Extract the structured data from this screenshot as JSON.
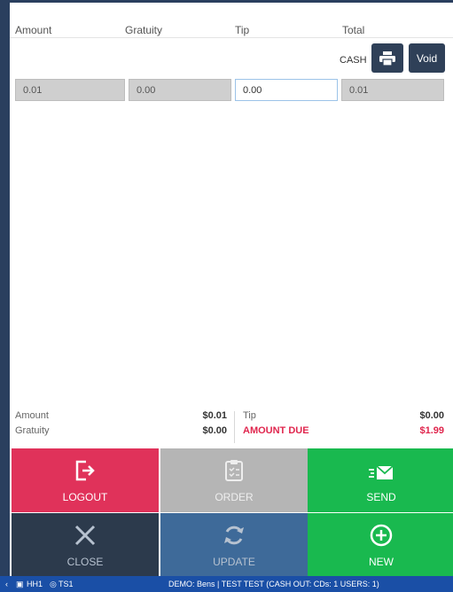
{
  "headers": {
    "amount": "Amount",
    "gratuity": "Gratuity",
    "tip": "Tip",
    "total": "Total"
  },
  "payment": {
    "method": "CASH",
    "void_label": "Void",
    "amount": "0.01",
    "gratuity": "0.00",
    "tip": "0.00",
    "total": "0.01"
  },
  "summary": {
    "amount_label": "Amount",
    "amount_value": "$0.01",
    "gratuity_label": "Gratuity",
    "gratuity_value": "$0.00",
    "tip_label": "Tip",
    "tip_value": "$0.00",
    "due_label": "AMOUNT DUE",
    "due_value": "$1.99"
  },
  "actions": {
    "logout": "LOGOUT",
    "order": "ORDER",
    "send": "SEND",
    "close": "CLOSE",
    "update": "UPDATE",
    "new": "NEW"
  },
  "status_bar": {
    "left": "HH1",
    "station": "TS1",
    "center": "DEMO: Bens | TEST TEST (CASH OUT: CDs: 1 USERS: 1)"
  },
  "colors": {
    "logout": "#e0325a",
    "order": "#b5b5b5",
    "send": "#19b94f",
    "close": "#2c3a4c",
    "update": "#3e6a99",
    "new": "#19b94f",
    "due": "#e0254d"
  },
  "icons": {
    "print": "printer-icon",
    "logout": "logout-icon",
    "order": "clipboard-icon",
    "send": "envelope-icon",
    "close": "x-icon",
    "update": "refresh-icon",
    "new": "plus-circle-icon"
  }
}
